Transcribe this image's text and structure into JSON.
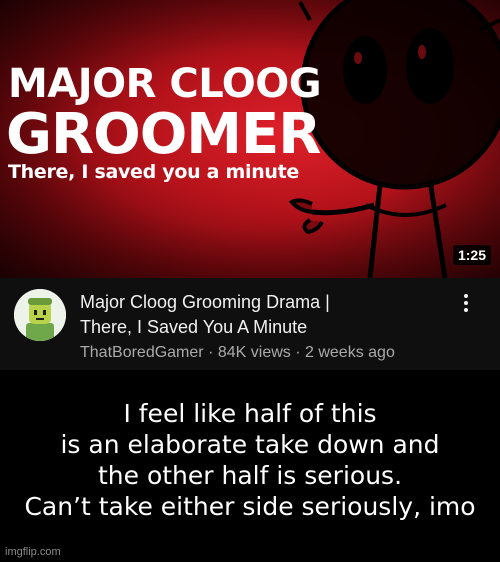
{
  "thumbnail": {
    "title_line_1": "MAJOR CLOOG",
    "title_line_2": "GROOMER",
    "subtitle": "There, I saved you a minute",
    "duration": "1:25",
    "background_color": "#c0141c"
  },
  "video": {
    "title_line_1": "Major Cloog Grooming Drama |",
    "title_line_2": "There, I Saved You A Minute",
    "channel": "ThatBoredGamer",
    "separator": "·",
    "views": "84K views",
    "uploaded": "2 weeks ago",
    "menu_icon": "more-vert-icon",
    "avatar_icon": "roblox-avatar-icon"
  },
  "caption": {
    "lines": [
      "I feel like half of this",
      "is an elaborate take down and",
      "the other half is serious.",
      "Can’t take either side seriously, imo"
    ]
  },
  "watermark": "imgflip.com"
}
